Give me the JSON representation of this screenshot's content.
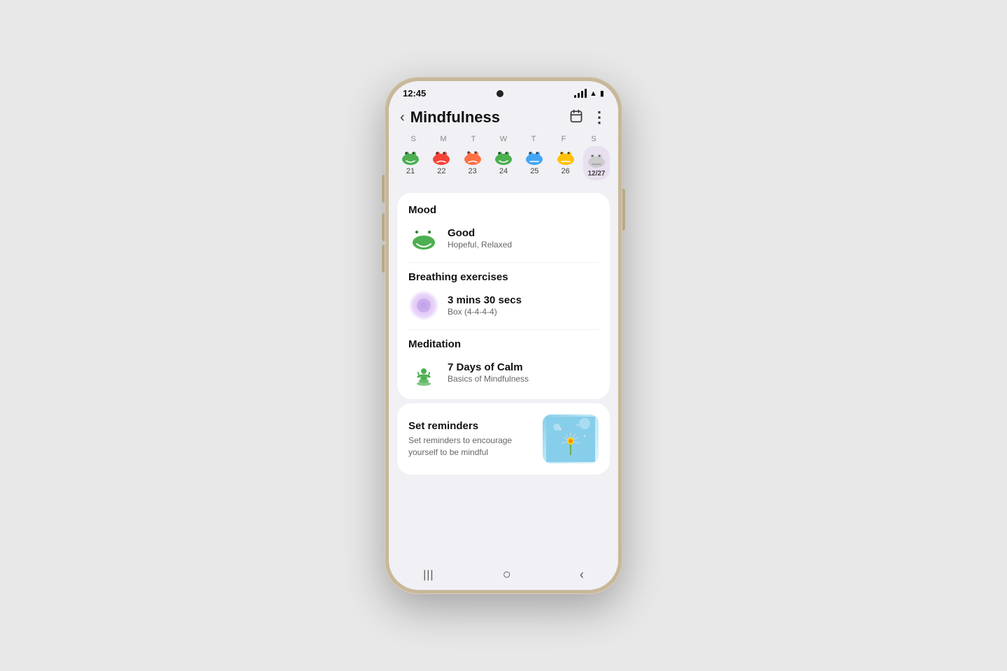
{
  "status_bar": {
    "time": "12:45"
  },
  "header": {
    "title": "Mindfulness",
    "back_label": "‹",
    "calendar_icon": "📅",
    "more_icon": "⋮"
  },
  "calendar": {
    "day_headers": [
      "S",
      "M",
      "T",
      "W",
      "T",
      "F",
      "S"
    ],
    "days": [
      {
        "num": "21",
        "face_color": "#4caf50",
        "face_type": "happy"
      },
      {
        "num": "22",
        "face_color": "#f44336",
        "face_type": "sad"
      },
      {
        "num": "23",
        "face_color": "#ff7043",
        "face_type": "unhappy"
      },
      {
        "num": "24",
        "face_color": "#4caf50",
        "face_type": "happy"
      },
      {
        "num": "25",
        "face_color": "#42a5f5",
        "face_type": "neutral"
      },
      {
        "num": "26",
        "face_color": "#ffc107",
        "face_type": "meh"
      },
      {
        "num": "12/27",
        "face_color": "#9e9e9e",
        "face_type": "today",
        "today": true
      }
    ]
  },
  "mood_section": {
    "title": "Mood",
    "mood_label": "Good",
    "mood_sub": "Hopeful, Relaxed",
    "mood_color": "#4caf50"
  },
  "breathing_section": {
    "title": "Breathing exercises",
    "duration": "3 mins 30 secs",
    "type": "Box (4-4-4-4)"
  },
  "meditation_section": {
    "title": "Meditation",
    "program": "7 Days of Calm",
    "sub": "Basics of Mindfulness"
  },
  "reminders_section": {
    "title": "Set reminders",
    "description": "Set reminders to encourage yourself to be mindful"
  },
  "nav": {
    "recent_icon": "|||",
    "home_icon": "○",
    "back_icon": "<"
  }
}
